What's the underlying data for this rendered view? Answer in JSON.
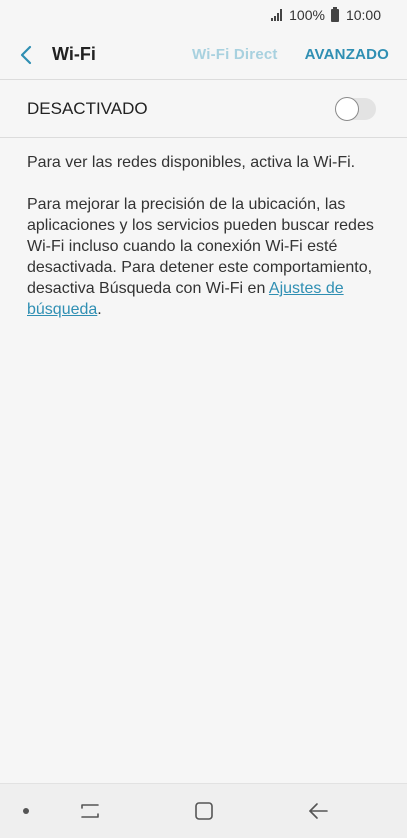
{
  "status_bar": {
    "battery": "100%",
    "time": "10:00"
  },
  "header": {
    "title": "Wi-Fi",
    "wifi_direct": "Wi-Fi Direct",
    "advanced": "AVANZADO"
  },
  "toggle": {
    "label": "DESACTIVADO",
    "state": "off"
  },
  "content": {
    "paragraph1": "Para ver las redes disponibles, activa la Wi-Fi.",
    "paragraph2_text": "Para mejorar la precisión de la ubicación, las aplicaciones y los servicios pueden buscar redes Wi-Fi incluso cuando la conexión Wi-Fi esté desactivada. Para detener este comportamiento, desactiva Búsqueda con Wi-Fi en ",
    "paragraph2_link": "Ajustes de búsqueda",
    "paragraph2_end": "."
  },
  "colors": {
    "accent": "#2f8fb3",
    "accent_disabled": "#a8d1df",
    "background": "#f6f6f6"
  },
  "icons": {
    "back": "chevron-left-icon",
    "signal": "signal-icon",
    "battery": "battery-icon",
    "recents": "recents-icon",
    "home": "home-icon",
    "nav_back": "arrow-left-icon"
  }
}
